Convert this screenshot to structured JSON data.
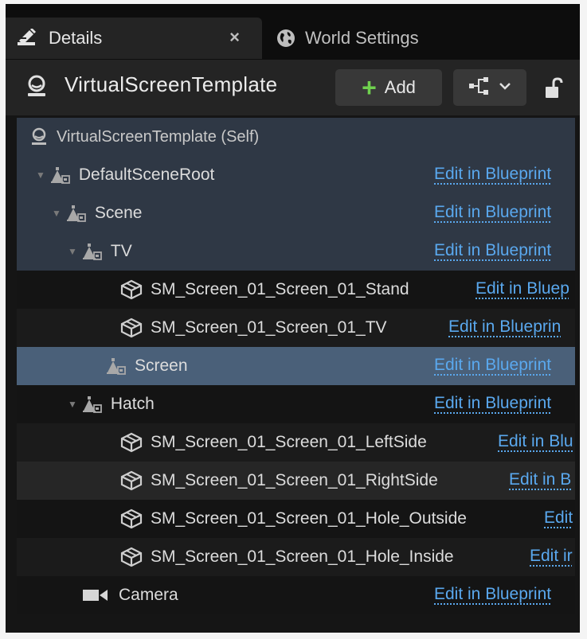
{
  "tabs": [
    {
      "label": "Details",
      "icon": "details-icon",
      "active": true
    },
    {
      "label": "World Settings",
      "icon": "globe-icon",
      "active": false
    }
  ],
  "tab_close_glyph": "×",
  "header": {
    "actor_name": "VirtualScreenTemplate",
    "add_label": "Add"
  },
  "tree": {
    "edit_label": "Edit in Blueprint",
    "rows": [
      {
        "label": "VirtualScreenTemplate (Self)",
        "icon": "actor-icon",
        "depth": 0,
        "edit": ""
      },
      {
        "label": "DefaultSceneRoot",
        "icon": "scene-component-icon",
        "depth": 1,
        "edit": "Edit in Blueprint"
      },
      {
        "label": "Scene",
        "icon": "scene-component-icon",
        "depth": 2,
        "edit": "Edit in Blueprint"
      },
      {
        "label": "TV",
        "icon": "scene-component-icon",
        "depth": 3,
        "edit": "Edit in Blueprint"
      },
      {
        "label": "SM_Screen_01_Screen_01_Stand",
        "icon": "static-mesh-icon",
        "depth": 4,
        "edit": "Edit in Bluep"
      },
      {
        "label": "SM_Screen_01_Screen_01_TV",
        "icon": "static-mesh-icon",
        "depth": 4,
        "edit": "Edit in Blueprin"
      },
      {
        "label": "Screen",
        "icon": "scene-component-icon",
        "depth": 4,
        "edit": "Edit in Blueprint"
      },
      {
        "label": "Hatch",
        "icon": "scene-component-icon",
        "depth": 3,
        "edit": "Edit in Blueprint"
      },
      {
        "label": "SM_Screen_01_Screen_01_LeftSide",
        "icon": "static-mesh-icon",
        "depth": 4,
        "edit": "Edit in Blu"
      },
      {
        "label": "SM_Screen_01_Screen_01_RightSide",
        "icon": "static-mesh-icon",
        "depth": 4,
        "edit": "Edit in B"
      },
      {
        "label": "SM_Screen_01_Screen_01_Hole_Outside",
        "icon": "static-mesh-icon",
        "depth": 4,
        "edit": "Edit"
      },
      {
        "label": "SM_Screen_01_Screen_01_Hole_Inside",
        "icon": "static-mesh-icon",
        "depth": 4,
        "edit": "Edit ir"
      },
      {
        "label": "Camera",
        "icon": "camera-icon",
        "depth": 3,
        "edit": "Edit in Blueprint"
      }
    ]
  },
  "colors": {
    "panel_bg": "#151515",
    "link": "#5aa8ee",
    "selected_row": "#4a6079",
    "add_plus": "#6fd14e"
  }
}
